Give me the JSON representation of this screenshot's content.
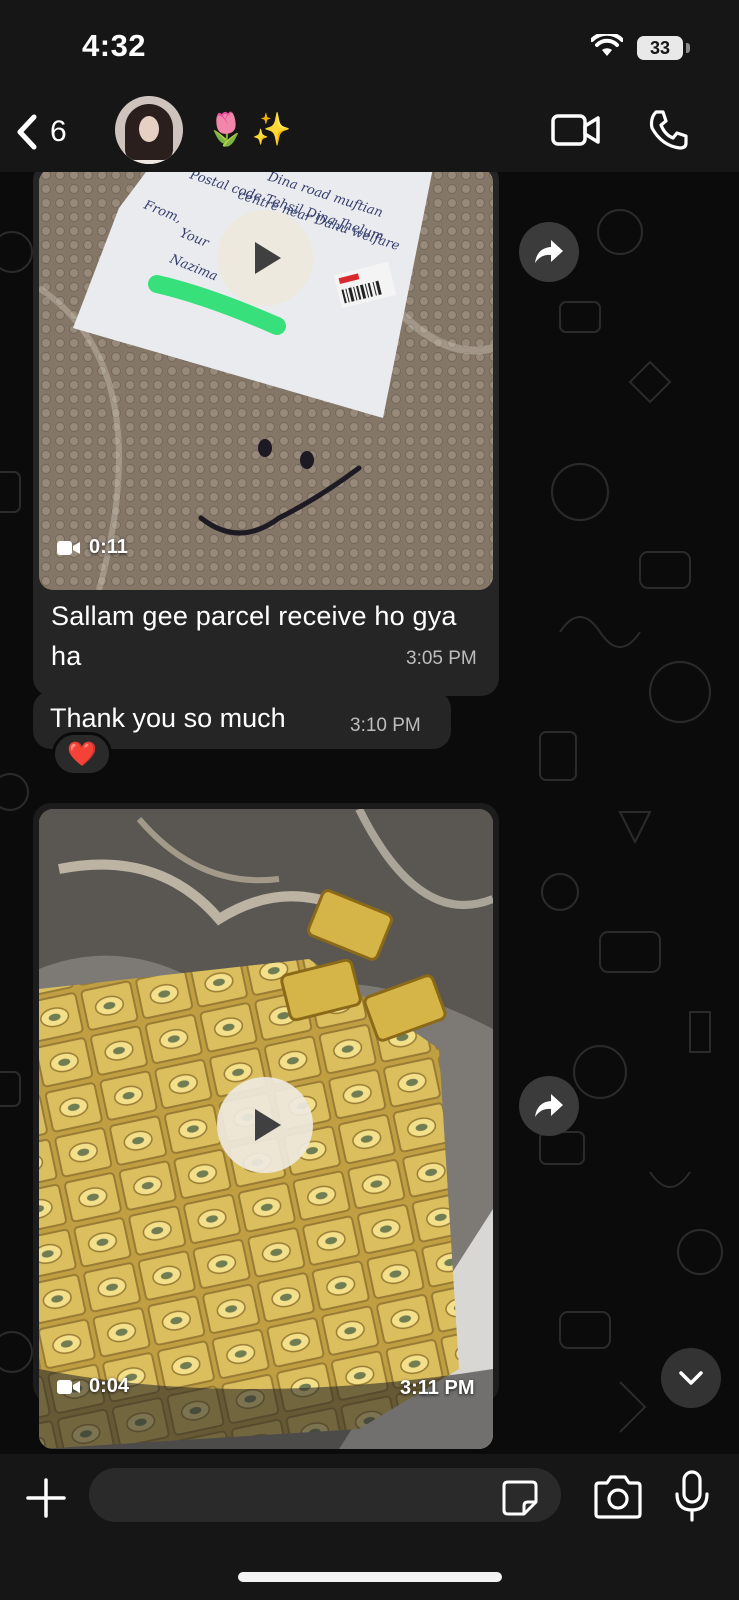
{
  "status_bar": {
    "time": "4:32",
    "battery": "33"
  },
  "header": {
    "back_count": "6",
    "contact_name": "🌷✨",
    "icons": {
      "back": "chevron-left-icon",
      "video": "video-camera-icon",
      "call": "phone-icon"
    }
  },
  "messages": [
    {
      "type": "video",
      "duration": "0:11",
      "caption": "Sallam gee parcel receive ho gya ha",
      "time": "3:05 PM",
      "note_lines": [
        "Dina road muftian",
        "centre near Dahu welfare",
        "Postal code  Tehsil Dina Jhelum",
        "From,",
        "Your",
        "Nazima"
      ]
    },
    {
      "type": "text",
      "text": "Thank you so much",
      "time": "3:10 PM",
      "reaction": "❤️"
    },
    {
      "type": "video",
      "duration": "0:04",
      "time": "3:11 PM"
    }
  ],
  "composer": {
    "placeholder": "",
    "icons": {
      "attach": "plus-icon",
      "sticker": "sticker-icon",
      "camera": "camera-icon",
      "mic": "microphone-icon"
    }
  },
  "colors": {
    "background": "#0b0b0b",
    "bar": "#161616",
    "bubble": "#252525",
    "time": "#bdbdbd"
  }
}
